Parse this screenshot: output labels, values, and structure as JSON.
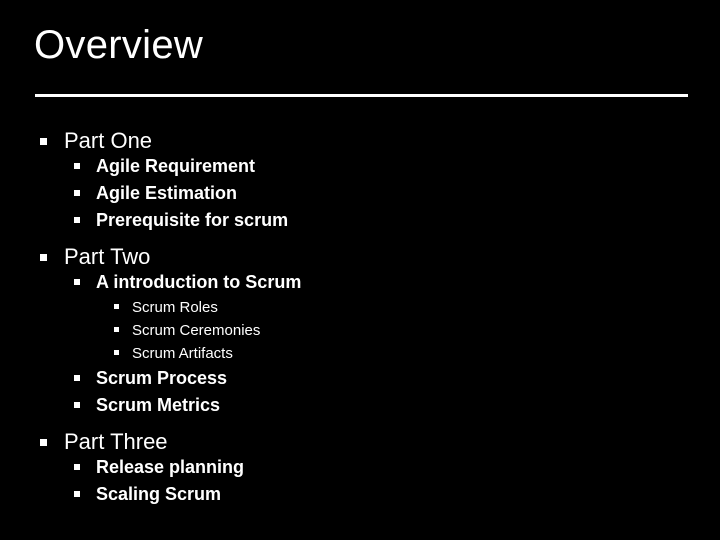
{
  "slide": {
    "title": "Overview",
    "background_color": "#000000",
    "text_color": "#ffffff",
    "rule_color": "#ffffff",
    "bullet_glyph": "square-bullet",
    "outline": [
      {
        "level": 1,
        "text": "Part One"
      },
      {
        "level": 2,
        "text": "Agile Requirement"
      },
      {
        "level": 2,
        "text": "Agile Estimation"
      },
      {
        "level": 2,
        "text": "Prerequisite for scrum"
      },
      {
        "level": 1,
        "text": "Part Two"
      },
      {
        "level": 2,
        "text": "A introduction to Scrum"
      },
      {
        "level": 3,
        "text": "Scrum Roles"
      },
      {
        "level": 3,
        "text": "Scrum Ceremonies"
      },
      {
        "level": 3,
        "text": "Scrum Artifacts"
      },
      {
        "level": 2,
        "text": "Scrum Process"
      },
      {
        "level": 2,
        "text": "Scrum Metrics"
      },
      {
        "level": 1,
        "text": "Part Three"
      },
      {
        "level": 2,
        "text": "Release planning"
      },
      {
        "level": 2,
        "text": "Scaling Scrum"
      }
    ]
  }
}
